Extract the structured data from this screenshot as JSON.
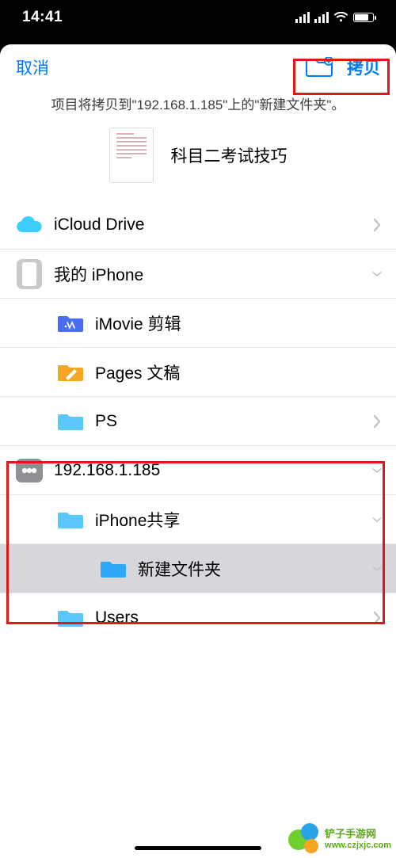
{
  "status": {
    "time": "14:41"
  },
  "nav": {
    "cancel": "取消",
    "copy": "拷贝"
  },
  "subtitle": "项目将拷贝到\"192.168.1.185\"上的\"新建文件夹\"。",
  "file": {
    "name": "科目二考试技巧"
  },
  "locations": {
    "icloud": "iCloud Drive",
    "iphone": "我的 iPhone",
    "imovie": "iMovie 剪辑",
    "pages": "Pages 文稿",
    "ps": "PS",
    "server": "192.168.1.185",
    "share": "iPhone共享",
    "newfolder": "新建文件夹",
    "users": "Users"
  },
  "folder_colors": {
    "default": "#5ac8fa",
    "imovie": "#4a6cf2",
    "pages": "#f5a623",
    "selected": "#2ea8f7"
  },
  "watermark": {
    "name": "铲子手游网",
    "url": "www.czjxjc.com"
  }
}
